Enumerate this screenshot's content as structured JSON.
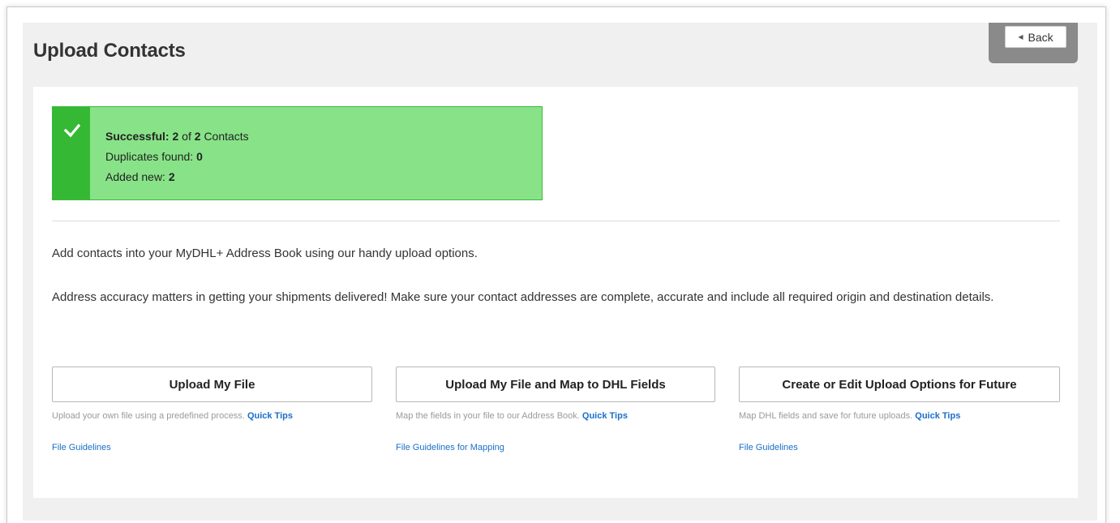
{
  "header": {
    "title": "Upload Contacts",
    "back_label": "Back"
  },
  "alert": {
    "status": "success",
    "line1": {
      "label": "Successful:",
      "count": "2",
      "of": "of",
      "total": "2",
      "suffix": "Contacts"
    },
    "line2": {
      "label": "Duplicates found:",
      "value": "0"
    },
    "line3": {
      "label": "Added new:",
      "value": "2"
    }
  },
  "intro_text": "Add contacts into your MyDHL+ Address Book using our handy upload options.",
  "note_text": "Address accuracy matters in getting your shipments delivered! Make sure your contact addresses are complete, accurate and include all required origin and destination details.",
  "options": [
    {
      "button": "Upload My File",
      "description": "Upload your own file using a predefined process.",
      "tips": "Quick Tips",
      "guidelines": "File Guidelines"
    },
    {
      "button": "Upload My File and Map to DHL Fields",
      "description": "Map the fields in your file to our Address Book.",
      "tips": "Quick Tips",
      "guidelines": "File Guidelines for Mapping"
    },
    {
      "button": "Create or Edit Upload Options for Future",
      "description": "Map DHL fields and save for future uploads.",
      "tips": "Quick Tips",
      "guidelines": "File Guidelines"
    }
  ],
  "colors": {
    "alert_bg": "#88e388",
    "alert_icon_bg": "#35b935",
    "link": "#1a6fc9",
    "panel_bg": "#f0f0f0",
    "back_tab": "#8a8a8a"
  },
  "icons": {
    "alert": "check-icon",
    "back": "caret-left-icon"
  }
}
